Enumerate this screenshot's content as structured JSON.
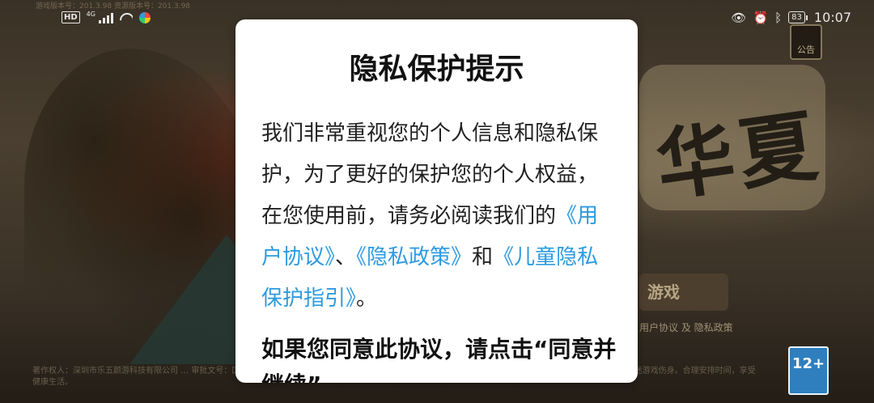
{
  "status_bar": {
    "hd_label": "HD",
    "network_label": "4G",
    "battery_level": "83",
    "time": "10:07"
  },
  "background": {
    "title_text": "华夏",
    "menu_label": "游戏",
    "links_text": "用户协议 及 隐私政策",
    "age_rating": "12+",
    "notice_label": "公告",
    "footer_text": "著作权人：深圳市乐五颜游科技有限公司 … 审批文号：国新出审〔2021〕1391号 … 抵制不良游戏，拒绝盗版游戏。注意自我保护，谨防受骗上当。适度游戏益脑，沉迷游戏伤身。合理安排时间，享受健康生活。",
    "header_text": "游戏版本号：201.3.98 资源版本号：201.3.98"
  },
  "dialog": {
    "title": "隐私保护提示",
    "body_intro": "我们非常重视您的个人信息和隐私保护，为了更好的保护您的个人权益，在您使用前，请务必阅读我们的",
    "link_user_agreement": "《用户协议》",
    "separator": "、",
    "link_privacy_policy": "《隐私政策》",
    "conjunction": "和",
    "link_child_privacy": "《儿童隐私保护指引》",
    "period": "。",
    "bold_text": "如果您同意此协议，请点击“同意并继续”。"
  }
}
